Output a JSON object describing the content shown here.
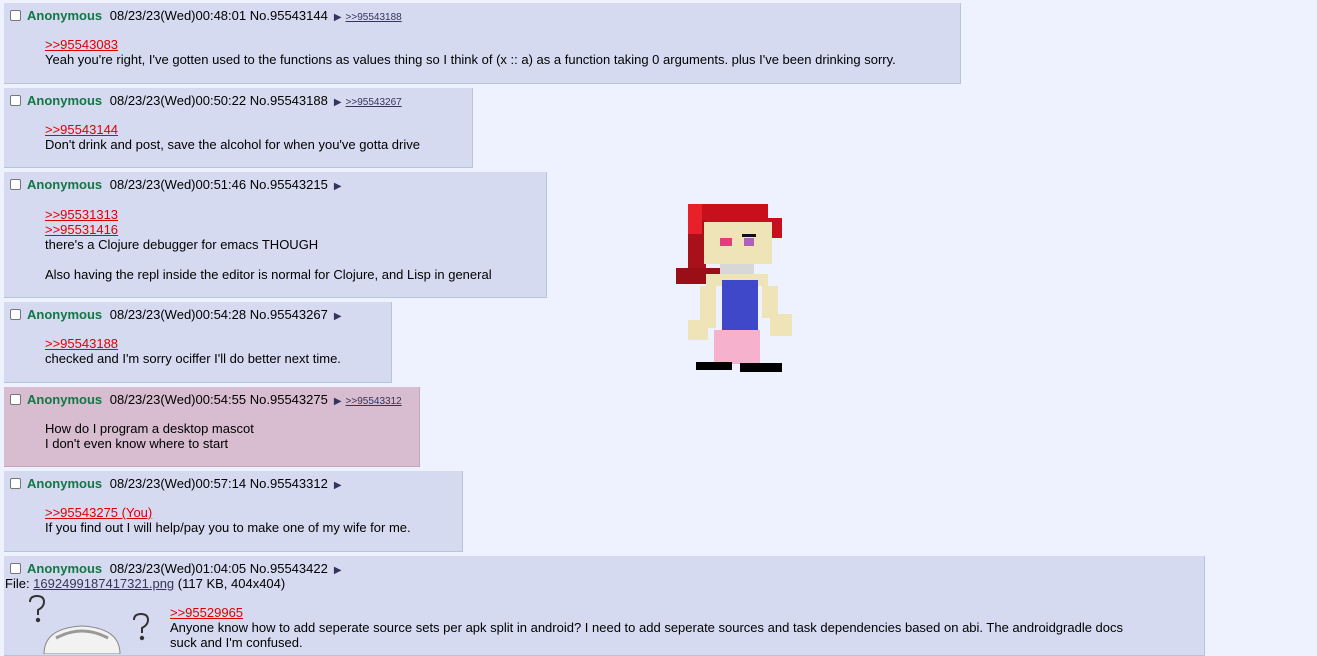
{
  "posts": [
    {
      "name": "Anonymous",
      "datetime": "08/23/23(Wed)00:48:01",
      "number": "No.95543144",
      "backlinks": ">>95543188",
      "quotes": [
        ">>95543083"
      ],
      "lines": [
        "Yeah you're right, I've gotten used to the functions as values thing so I think of (x :: a) as a function taking 0 arguments. plus I've been drinking sorry."
      ]
    },
    {
      "name": "Anonymous",
      "datetime": "08/23/23(Wed)00:50:22",
      "number": "No.95543188",
      "backlinks": ">>95543267",
      "quotes": [
        ">>95543144"
      ],
      "lines": [
        "Don't drink and post, save the alcohol for when you've gotta drive"
      ]
    },
    {
      "name": "Anonymous",
      "datetime": "08/23/23(Wed)00:51:46",
      "number": "No.95543215",
      "backlinks": "",
      "quotes": [
        ">>95531313",
        ">>95531416"
      ],
      "lines": [
        "there's a Clojure debugger for emacs THOUGH",
        "",
        "Also having the repl inside the editor is normal for Clojure, and Lisp in general"
      ]
    },
    {
      "name": "Anonymous",
      "datetime": "08/23/23(Wed)00:54:28",
      "number": "No.95543267",
      "backlinks": "",
      "quotes": [
        ">>95543188"
      ],
      "lines": [
        "checked and I'm sorry ociffer I'll do better next time."
      ]
    },
    {
      "name": "Anonymous",
      "datetime": "08/23/23(Wed)00:54:55",
      "number": "No.95543275",
      "backlinks": ">>95543312",
      "quotes": [],
      "lines": [
        "How do I program a desktop mascot",
        "I don't even know where to start"
      ]
    },
    {
      "name": "Anonymous",
      "datetime": "08/23/23(Wed)00:57:14",
      "number": "No.95543312",
      "backlinks": "",
      "quotes": [
        ">>95543275 (You)"
      ],
      "lines": [
        "If you find out I will help/pay you to make one of my wife for me."
      ]
    },
    {
      "name": "Anonymous",
      "datetime": "08/23/23(Wed)01:04:05",
      "number": "No.95543422",
      "backlinks": "",
      "file_label": "File: ",
      "file_name": "1692499187417321.png",
      "file_meta": "(117 KB, 404x404)",
      "quotes": [
        ">>95529965"
      ],
      "lines": [
        "Anyone know how to add seperate source sets per apk split in android? I need to add seperate sources and task dependencies based on abi. The androidgradle docs",
        "suck and I'm confused."
      ]
    }
  ],
  "colors": {
    "background": "#eef2ff",
    "post_bg": "#d6daf0",
    "own_post_bg": "#d8bccf",
    "name": "#117743",
    "quote_link": "#dd0000"
  },
  "icons": [
    "checkbox-icon",
    "post-menu-arrow-icon",
    "pixel-mascot-sprite",
    "question-mark-icon"
  ]
}
